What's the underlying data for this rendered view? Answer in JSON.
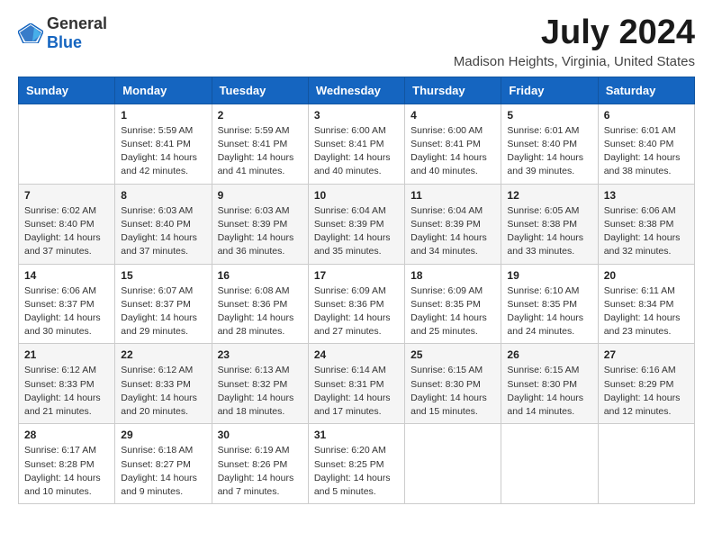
{
  "logo": {
    "text_general": "General",
    "text_blue": "Blue"
  },
  "title": "July 2024",
  "subtitle": "Madison Heights, Virginia, United States",
  "days": [
    "Sunday",
    "Monday",
    "Tuesday",
    "Wednesday",
    "Thursday",
    "Friday",
    "Saturday"
  ],
  "weeks": [
    [
      {
        "date": "",
        "sunrise": "",
        "sunset": "",
        "daylight": ""
      },
      {
        "date": "1",
        "sunrise": "Sunrise: 5:59 AM",
        "sunset": "Sunset: 8:41 PM",
        "daylight": "Daylight: 14 hours and 42 minutes."
      },
      {
        "date": "2",
        "sunrise": "Sunrise: 5:59 AM",
        "sunset": "Sunset: 8:41 PM",
        "daylight": "Daylight: 14 hours and 41 minutes."
      },
      {
        "date": "3",
        "sunrise": "Sunrise: 6:00 AM",
        "sunset": "Sunset: 8:41 PM",
        "daylight": "Daylight: 14 hours and 40 minutes."
      },
      {
        "date": "4",
        "sunrise": "Sunrise: 6:00 AM",
        "sunset": "Sunset: 8:41 PM",
        "daylight": "Daylight: 14 hours and 40 minutes."
      },
      {
        "date": "5",
        "sunrise": "Sunrise: 6:01 AM",
        "sunset": "Sunset: 8:40 PM",
        "daylight": "Daylight: 14 hours and 39 minutes."
      },
      {
        "date": "6",
        "sunrise": "Sunrise: 6:01 AM",
        "sunset": "Sunset: 8:40 PM",
        "daylight": "Daylight: 14 hours and 38 minutes."
      }
    ],
    [
      {
        "date": "7",
        "sunrise": "Sunrise: 6:02 AM",
        "sunset": "Sunset: 8:40 PM",
        "daylight": "Daylight: 14 hours and 37 minutes."
      },
      {
        "date": "8",
        "sunrise": "Sunrise: 6:03 AM",
        "sunset": "Sunset: 8:40 PM",
        "daylight": "Daylight: 14 hours and 37 minutes."
      },
      {
        "date": "9",
        "sunrise": "Sunrise: 6:03 AM",
        "sunset": "Sunset: 8:39 PM",
        "daylight": "Daylight: 14 hours and 36 minutes."
      },
      {
        "date": "10",
        "sunrise": "Sunrise: 6:04 AM",
        "sunset": "Sunset: 8:39 PM",
        "daylight": "Daylight: 14 hours and 35 minutes."
      },
      {
        "date": "11",
        "sunrise": "Sunrise: 6:04 AM",
        "sunset": "Sunset: 8:39 PM",
        "daylight": "Daylight: 14 hours and 34 minutes."
      },
      {
        "date": "12",
        "sunrise": "Sunrise: 6:05 AM",
        "sunset": "Sunset: 8:38 PM",
        "daylight": "Daylight: 14 hours and 33 minutes."
      },
      {
        "date": "13",
        "sunrise": "Sunrise: 6:06 AM",
        "sunset": "Sunset: 8:38 PM",
        "daylight": "Daylight: 14 hours and 32 minutes."
      }
    ],
    [
      {
        "date": "14",
        "sunrise": "Sunrise: 6:06 AM",
        "sunset": "Sunset: 8:37 PM",
        "daylight": "Daylight: 14 hours and 30 minutes."
      },
      {
        "date": "15",
        "sunrise": "Sunrise: 6:07 AM",
        "sunset": "Sunset: 8:37 PM",
        "daylight": "Daylight: 14 hours and 29 minutes."
      },
      {
        "date": "16",
        "sunrise": "Sunrise: 6:08 AM",
        "sunset": "Sunset: 8:36 PM",
        "daylight": "Daylight: 14 hours and 28 minutes."
      },
      {
        "date": "17",
        "sunrise": "Sunrise: 6:09 AM",
        "sunset": "Sunset: 8:36 PM",
        "daylight": "Daylight: 14 hours and 27 minutes."
      },
      {
        "date": "18",
        "sunrise": "Sunrise: 6:09 AM",
        "sunset": "Sunset: 8:35 PM",
        "daylight": "Daylight: 14 hours and 25 minutes."
      },
      {
        "date": "19",
        "sunrise": "Sunrise: 6:10 AM",
        "sunset": "Sunset: 8:35 PM",
        "daylight": "Daylight: 14 hours and 24 minutes."
      },
      {
        "date": "20",
        "sunrise": "Sunrise: 6:11 AM",
        "sunset": "Sunset: 8:34 PM",
        "daylight": "Daylight: 14 hours and 23 minutes."
      }
    ],
    [
      {
        "date": "21",
        "sunrise": "Sunrise: 6:12 AM",
        "sunset": "Sunset: 8:33 PM",
        "daylight": "Daylight: 14 hours and 21 minutes."
      },
      {
        "date": "22",
        "sunrise": "Sunrise: 6:12 AM",
        "sunset": "Sunset: 8:33 PM",
        "daylight": "Daylight: 14 hours and 20 minutes."
      },
      {
        "date": "23",
        "sunrise": "Sunrise: 6:13 AM",
        "sunset": "Sunset: 8:32 PM",
        "daylight": "Daylight: 14 hours and 18 minutes."
      },
      {
        "date": "24",
        "sunrise": "Sunrise: 6:14 AM",
        "sunset": "Sunset: 8:31 PM",
        "daylight": "Daylight: 14 hours and 17 minutes."
      },
      {
        "date": "25",
        "sunrise": "Sunrise: 6:15 AM",
        "sunset": "Sunset: 8:30 PM",
        "daylight": "Daylight: 14 hours and 15 minutes."
      },
      {
        "date": "26",
        "sunrise": "Sunrise: 6:15 AM",
        "sunset": "Sunset: 8:30 PM",
        "daylight": "Daylight: 14 hours and 14 minutes."
      },
      {
        "date": "27",
        "sunrise": "Sunrise: 6:16 AM",
        "sunset": "Sunset: 8:29 PM",
        "daylight": "Daylight: 14 hours and 12 minutes."
      }
    ],
    [
      {
        "date": "28",
        "sunrise": "Sunrise: 6:17 AM",
        "sunset": "Sunset: 8:28 PM",
        "daylight": "Daylight: 14 hours and 10 minutes."
      },
      {
        "date": "29",
        "sunrise": "Sunrise: 6:18 AM",
        "sunset": "Sunset: 8:27 PM",
        "daylight": "Daylight: 14 hours and 9 minutes."
      },
      {
        "date": "30",
        "sunrise": "Sunrise: 6:19 AM",
        "sunset": "Sunset: 8:26 PM",
        "daylight": "Daylight: 14 hours and 7 minutes."
      },
      {
        "date": "31",
        "sunrise": "Sunrise: 6:20 AM",
        "sunset": "Sunset: 8:25 PM",
        "daylight": "Daylight: 14 hours and 5 minutes."
      },
      {
        "date": "",
        "sunrise": "",
        "sunset": "",
        "daylight": ""
      },
      {
        "date": "",
        "sunrise": "",
        "sunset": "",
        "daylight": ""
      },
      {
        "date": "",
        "sunrise": "",
        "sunset": "",
        "daylight": ""
      }
    ]
  ]
}
